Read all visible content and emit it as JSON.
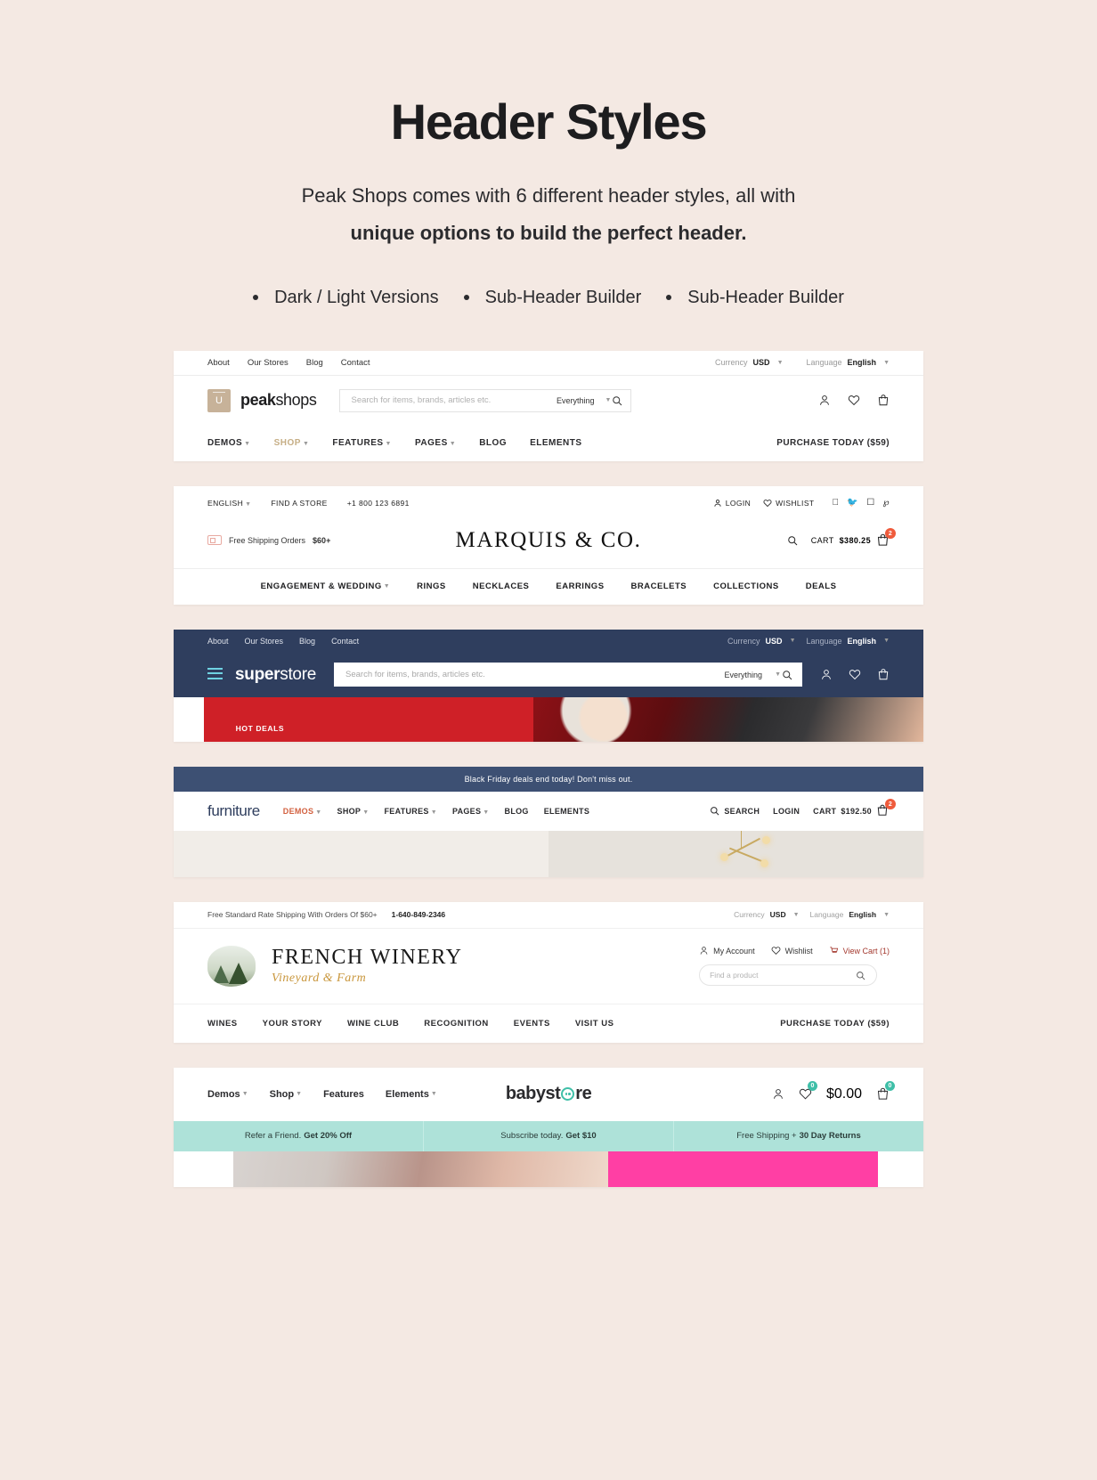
{
  "intro": {
    "title": "Header Styles",
    "subtitle_line1": "Peak Shops comes with 6 different header styles, all with",
    "subtitle_line2": "unique options to build the perfect header.",
    "features": [
      "Dark / Light Versions",
      "Sub-Header Builder",
      "Sub-Header Builder"
    ]
  },
  "peakshops": {
    "topbar": {
      "links": [
        "About",
        "Our Stores",
        "Blog",
        "Contact"
      ],
      "currency_label": "Currency",
      "currency_value": "USD",
      "language_label": "Language",
      "language_value": "English"
    },
    "logo": {
      "bold": "peak",
      "light": "shops"
    },
    "search": {
      "placeholder": "Search for items, brands, articles etc.",
      "scope": "Everything"
    },
    "nav": [
      "DEMOS",
      "SHOP",
      "FEATURES",
      "PAGES",
      "BLOG",
      "ELEMENTS"
    ],
    "nav_active": "SHOP",
    "cta": "PURCHASE TODAY ($59)"
  },
  "marquis": {
    "topbar": {
      "language": "ENGLISH",
      "find_store": "FIND A STORE",
      "phone": "+1 800 123 6891",
      "login": "LOGIN",
      "wishlist": "WISHLIST"
    },
    "shipping": {
      "text": "Free Shipping Orders ",
      "amount": "$60+"
    },
    "logo": "MARQUIS & CO.",
    "cart": {
      "label": "CART",
      "amount": "$380.25",
      "count": "2"
    },
    "nav": [
      "ENGAGEMENT & WEDDING",
      "RINGS",
      "NECKLACES",
      "EARRINGS",
      "BRACELETS",
      "COLLECTIONS",
      "DEALS"
    ]
  },
  "superstore": {
    "topbar": {
      "links": [
        "About",
        "Our Stores",
        "Blog",
        "Contact"
      ],
      "currency_label": "Currency",
      "currency_value": "USD",
      "language_label": "Language",
      "language_value": "English"
    },
    "logo": {
      "bold": "super",
      "light": "store"
    },
    "search": {
      "placeholder": "Search for items, brands, articles etc.",
      "scope": "Everything"
    },
    "banner_label": "HOT DEALS"
  },
  "furniture": {
    "announcement": "Black Friday deals end today! Don't miss out.",
    "logo": "furniture",
    "nav": [
      "DEMOS",
      "SHOP",
      "FEATURES",
      "PAGES",
      "BLOG",
      "ELEMENTS"
    ],
    "nav_active": "DEMOS",
    "search_label": "SEARCH",
    "login_label": "LOGIN",
    "cart": {
      "label": "CART",
      "amount": "$192.50",
      "count": "2"
    }
  },
  "winery": {
    "topbar": {
      "shipping": "Free Standard Rate Shipping With Orders Of $60+",
      "phone": "1-640-849-2346",
      "currency_label": "Currency",
      "currency_value": "USD",
      "language_label": "Language",
      "language_value": "English"
    },
    "logo_name": "FRENCH WINERY",
    "logo_tagline": "Vineyard & Farm",
    "account": "My Account",
    "wishlist": "Wishlist",
    "view_cart": "View Cart (1)",
    "search_placeholder": "Find a product",
    "nav": [
      "WINES",
      "YOUR STORY",
      "WINE CLUB",
      "RECOGNITION",
      "EVENTS",
      "VISIT US"
    ],
    "cta": "PURCHASE TODAY ($59)"
  },
  "babystore": {
    "nav": [
      "Demos",
      "Shop",
      "Features",
      "Elements"
    ],
    "logo_pre": "babyst",
    "logo_post": "re",
    "wishlist_count": "0",
    "cart_total": "$0.00",
    "cart_count": "0",
    "promos": [
      {
        "text": "Refer a Friend. ",
        "bold": "Get 20% Off"
      },
      {
        "text": "Subscribe today. ",
        "bold": "Get $10"
      },
      {
        "text": "Free Shipping + ",
        "bold": "30 Day Returns"
      }
    ]
  },
  "colors": {
    "page_bg": "#f4e9e3",
    "peak_accent": "#c6ae85",
    "navy": "#2f3e5e",
    "teal": "#3fbfa8",
    "orange_badge": "#ef5b3c",
    "red": "#cf2027"
  }
}
